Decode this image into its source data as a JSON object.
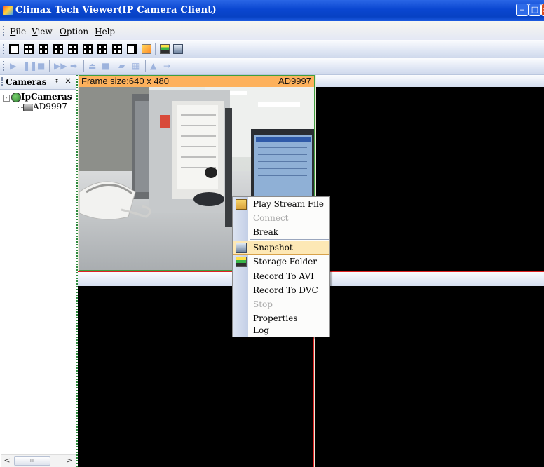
{
  "window": {
    "title": "Climax Tech Viewer(IP Camera Client)",
    "controls": {
      "minimize": "‒",
      "maximize": "□",
      "close": "x"
    }
  },
  "menubar": {
    "items": [
      {
        "label": "File",
        "u": "F",
        "rest": "ile"
      },
      {
        "label": "View",
        "u": "V",
        "rest": "iew"
      },
      {
        "label": "Option",
        "u": "O",
        "rest": "ption"
      },
      {
        "label": "Help",
        "u": "H",
        "rest": "elp"
      }
    ]
  },
  "toolbar_layout": {
    "icons": [
      "single-view-icon",
      "quad-view-icon",
      "six-view-icon",
      "seven-view-icon",
      "eight-view-icon",
      "nine-view-icon",
      "ten-view-icon",
      "thirteen-view-icon",
      "sixteen-view-icon",
      "full-screen-icon",
      "storage-folder-icon",
      "snapshot-icon"
    ]
  },
  "toolbar_playback": {
    "icons": [
      "play-icon",
      "pause-icon",
      "stop-icon",
      "fast-forward-icon",
      "next-frame-icon",
      "eject-icon",
      "record-icon",
      "open-file-icon",
      "settings-icon",
      "upload-icon",
      "arrow-right-icon"
    ]
  },
  "sidebar": {
    "title": "Cameras",
    "pin_glyph": "ᵻ",
    "close_glyph": "×",
    "tree": {
      "root_label": "IpCameras",
      "expand_glyph": "-",
      "children": [
        {
          "label": "AD9997"
        }
      ]
    },
    "scroll": {
      "left": "<",
      "right": ">",
      "thumb": "III"
    }
  },
  "pane1": {
    "frame_size_label": "Frame size:640 x 480",
    "camera_name": "AD9997"
  },
  "context_menu": {
    "items": [
      {
        "label": "Play Stream File",
        "u": "",
        "enabled": true,
        "icon": "open-folder-icon"
      },
      {
        "label": "Connect",
        "enabled": false
      },
      {
        "label": "Break",
        "enabled": true
      },
      {
        "label": "Snapshot",
        "enabled": true,
        "highlighted": true,
        "icon": "camera-icon"
      },
      {
        "label": "Storage Folder",
        "enabled": true,
        "icon": "folder-window-icon"
      },
      {
        "label": "Record To AVI",
        "enabled": true
      },
      {
        "label": "Record To DVC",
        "enabled": true
      },
      {
        "label": "Stop",
        "enabled": false
      },
      {
        "label": "Properties",
        "enabled": true
      },
      {
        "label": "Log",
        "enabled": true
      }
    ]
  },
  "colors": {
    "titlebar": "#0a46d0",
    "pane_header": "#fdb15c",
    "pane_border": "#3f9f3f",
    "split_line": "#dd2222",
    "menu_highlight": "#fde8b5"
  }
}
